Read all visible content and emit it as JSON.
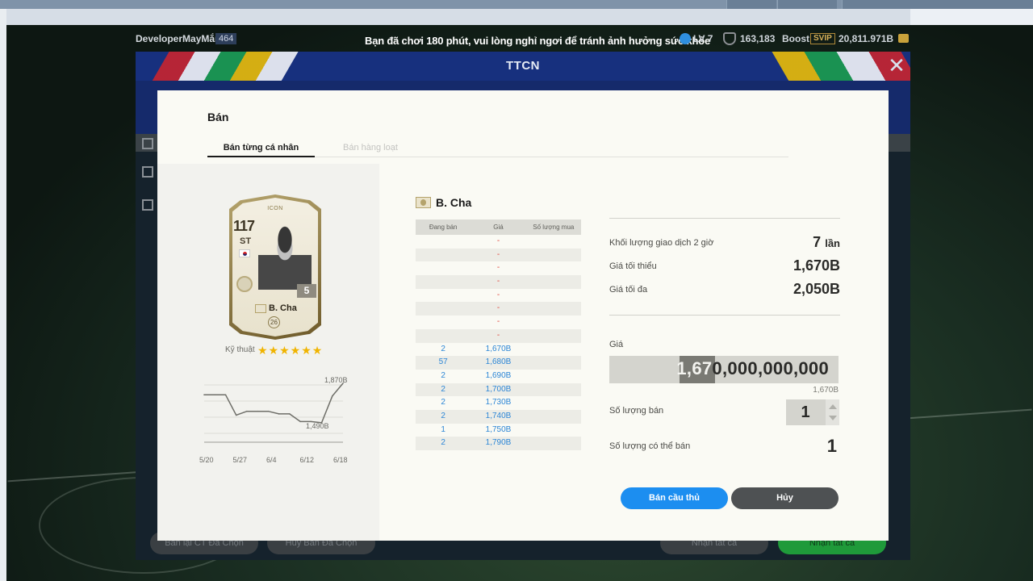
{
  "status_bar": {
    "username": "DeveloperMayMắn",
    "user_number": "464",
    "notice": "Bạn đã chơi 180 phút, vui lòng nghỉ ngơi để tránh ảnh hưởng sức khỏe",
    "level": "LV 7",
    "points": "163,183",
    "boost": "Boost",
    "svip": "SVIP",
    "money": "20,811.971B"
  },
  "ttcn": {
    "title": "TTCN",
    "close": "✕",
    "bottom_buttons": [
      "Bán lại CT Đã Chọn",
      "Hủy Bán Đã Chọn",
      "Nhận tất cả",
      "Nhận tất cả"
    ]
  },
  "dialog": {
    "title": "Bán",
    "tabs": [
      "Bán từng cá nhân",
      "Bán hàng loạt"
    ],
    "card": {
      "icon_label": "ICON",
      "ovr": "117",
      "position": "ST",
      "level": "5",
      "name": "B. Cha",
      "salary": "26",
      "skill_label": "Kỹ thuật",
      "skill_stars": 6,
      "stars_text": "★★★★★★"
    },
    "chart_data": {
      "type": "line",
      "x": [
        "5/20",
        "5/27",
        "6/4",
        "6/12",
        "6/18"
      ],
      "high_label": "1,870B",
      "low_label": "1,490B",
      "values": [
        1.78,
        1.78,
        1.78,
        1.62,
        1.65,
        1.65,
        1.65,
        1.63,
        1.63,
        1.57,
        1.57,
        1.56,
        1.77,
        1.87
      ]
    },
    "player_name": "B. Cha",
    "orders": {
      "headers": [
        "Đang bán",
        "Giá",
        "Số lượng mua"
      ],
      "rows": [
        [
          "",
          "-",
          ""
        ],
        [
          "",
          "-",
          ""
        ],
        [
          "",
          "-",
          ""
        ],
        [
          "",
          "-",
          ""
        ],
        [
          "",
          "-",
          ""
        ],
        [
          "",
          "-",
          ""
        ],
        [
          "",
          "-",
          ""
        ],
        [
          "",
          "-",
          ""
        ],
        [
          "2",
          "1,670B",
          ""
        ],
        [
          "57",
          "1,680B",
          ""
        ],
        [
          "2",
          "1,690B",
          ""
        ],
        [
          "2",
          "1,700B",
          ""
        ],
        [
          "2",
          "1,730B",
          ""
        ],
        [
          "2",
          "1,740B",
          ""
        ],
        [
          "1",
          "1,750B",
          ""
        ],
        [
          "2",
          "1,790B",
          ""
        ]
      ]
    },
    "info": {
      "volume_label": "Khối lượng giao dịch 2 giờ",
      "volume_value": "7",
      "volume_unit": "lần",
      "min_label": "Giá tối thiểu",
      "min_value": "1,670B",
      "max_label": "Giá tối đa",
      "max_value": "2,050B",
      "price_label": "Giá",
      "price_highlight": "1,67",
      "price_rest": "0,000,000,000",
      "price_hint": "1,670B",
      "qty_label": "Số lượng bán",
      "qty_value": "1",
      "available_label": "Số lượng có thể bán",
      "available_value": "1"
    },
    "buttons": {
      "sell": "Bán cầu thủ",
      "cancel": "Hủy"
    }
  }
}
